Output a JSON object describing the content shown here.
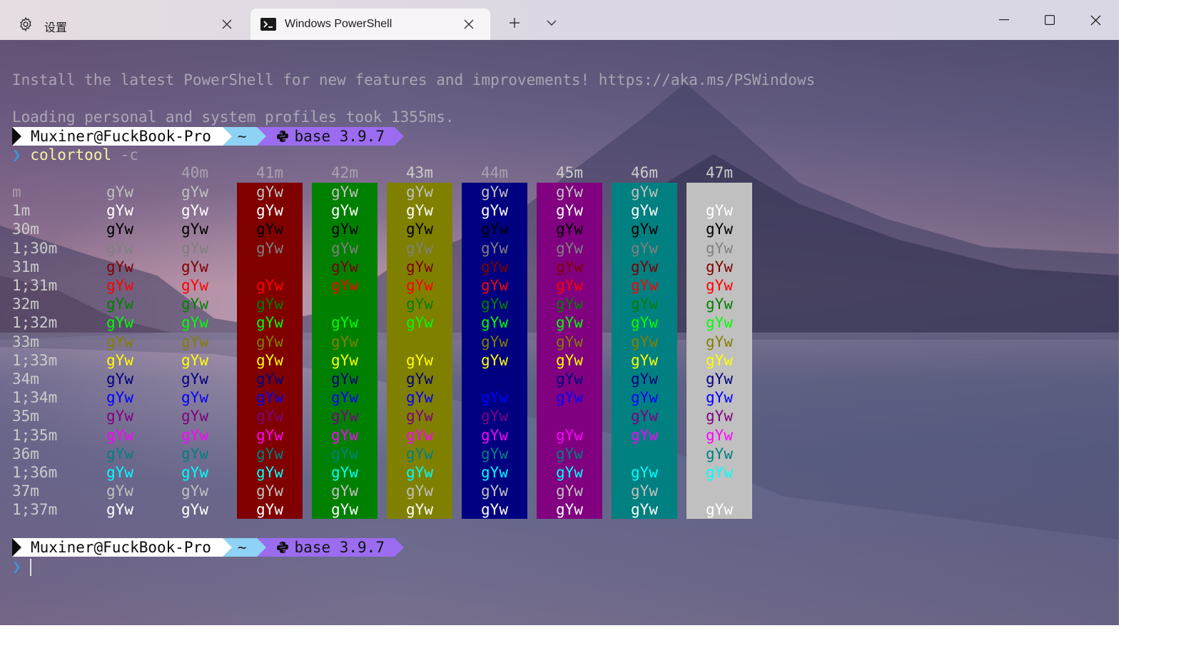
{
  "window": {
    "tabs": [
      {
        "label": "设置",
        "icon": "gear-icon",
        "active": false
      },
      {
        "label": "Windows PowerShell",
        "icon": "terminal-icon",
        "active": true
      }
    ],
    "new_tab_icon": "plus-icon",
    "dropdown_icon": "chevron-down-icon",
    "controls": [
      "minimize-icon",
      "maximize-icon",
      "close-icon"
    ]
  },
  "terminal": {
    "banner": "Install the latest PowerShell for new features and improvements! https://aka.ms/PSWindows",
    "profile_msg": "Loading personal and system profiles took 1355ms.",
    "prompt": {
      "user": "Muxiner@FuckBook-Pro",
      "dir": "~",
      "env": "base 3.9.7",
      "symbol": "❯"
    },
    "command": "colortool",
    "command_arg": " -c",
    "sample_text": "gYw",
    "colors": {
      "user_bg": "#ffffff",
      "dir_bg": "#8ed2f5",
      "env_bg": "#9b6cf0",
      "command": "#f9f1a5",
      "prompt_symbol": "#3a96dd"
    }
  },
  "color_table": {
    "bg_headers": [
      "40m",
      "41m",
      "42m",
      "43m",
      "44m",
      "45m",
      "46m",
      "47m"
    ],
    "bg_colors": [
      "transparent",
      "#800000",
      "#008000",
      "#808000",
      "#000080",
      "#800080",
      "#008080",
      "#c0c0c0"
    ],
    "fg_rows": [
      {
        "label": "m",
        "color": "#c0c0c0"
      },
      {
        "label": "1m",
        "color": "#ffffff"
      },
      {
        "label": "30m",
        "color": "#000000"
      },
      {
        "label": "1;30m",
        "color": "#808080"
      },
      {
        "label": "31m",
        "color": "#800000"
      },
      {
        "label": "1;31m",
        "color": "#ff0000"
      },
      {
        "label": "32m",
        "color": "#008000"
      },
      {
        "label": "1;32m",
        "color": "#00ff00"
      },
      {
        "label": "33m",
        "color": "#808000"
      },
      {
        "label": "1;33m",
        "color": "#ffff00"
      },
      {
        "label": "34m",
        "color": "#000080"
      },
      {
        "label": "1;34m",
        "color": "#0000ff"
      },
      {
        "label": "35m",
        "color": "#800080"
      },
      {
        "label": "1;35m",
        "color": "#ff00ff"
      },
      {
        "label": "36m",
        "color": "#008080"
      },
      {
        "label": "1;36m",
        "color": "#00ffff"
      },
      {
        "label": "37m",
        "color": "#c0c0c0"
      },
      {
        "label": "1;37m",
        "color": "#ffffff"
      }
    ]
  }
}
